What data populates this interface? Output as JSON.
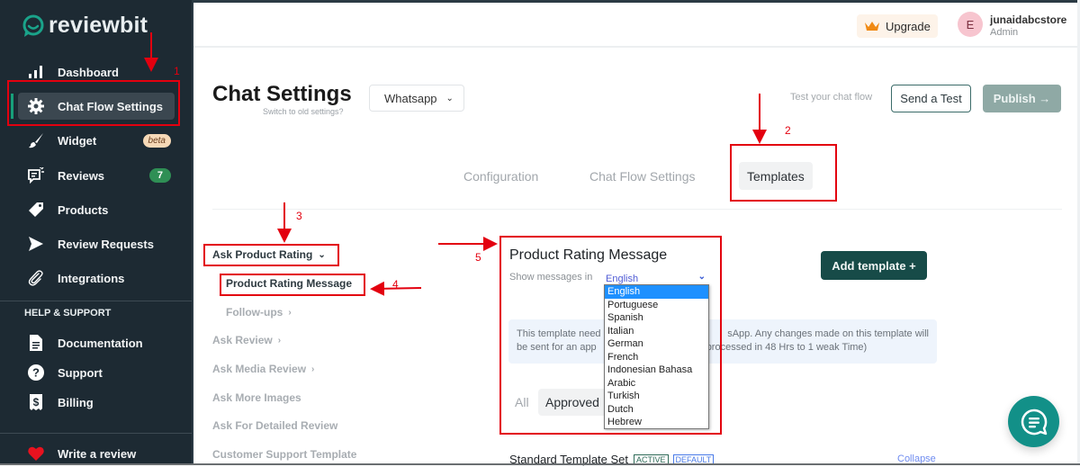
{
  "app": {
    "name": "reviewbit"
  },
  "sidebar": {
    "items": [
      {
        "label": "Dashboard",
        "icon": "bar-chart-icon"
      },
      {
        "label": "Chat Flow Settings",
        "icon": "gear-icon",
        "active": true
      },
      {
        "label": "Widget",
        "icon": "brush-icon",
        "badge": "beta"
      },
      {
        "label": "Reviews",
        "icon": "reviews-icon",
        "badge": "7"
      },
      {
        "label": "Products",
        "icon": "tag-icon"
      },
      {
        "label": "Review Requests",
        "icon": "send-icon"
      },
      {
        "label": "Integrations",
        "icon": "paperclip-icon"
      }
    ],
    "help_heading": "HELP & SUPPORT",
    "help_items": [
      {
        "label": "Documentation",
        "icon": "document-icon"
      },
      {
        "label": "Support",
        "icon": "question-icon"
      },
      {
        "label": "Billing",
        "icon": "billing-icon"
      }
    ],
    "footer_item": {
      "label": "Write a review",
      "icon": "heart-icon"
    }
  },
  "header": {
    "upgrade_label": "Upgrade",
    "user": {
      "initial": "E",
      "name": "junaidabcstore",
      "role": "Admin"
    }
  },
  "page": {
    "title": "Chat Settings",
    "switch_link": "Switch to old settings?",
    "channel": "Whatsapp",
    "test_label": "Test your chat flow",
    "send_test_label": "Send a Test",
    "publish_label": "Publish →"
  },
  "tabs": [
    {
      "label": "Configuration",
      "active": false
    },
    {
      "label": "Chat Flow Settings",
      "active": false
    },
    {
      "label": "Templates",
      "active": true
    }
  ],
  "template_menu": [
    {
      "label": "Ask Product Rating",
      "chevron": "down",
      "expanded": true
    },
    {
      "label": "Product Rating Message",
      "selected": true
    },
    {
      "label": "Follow-ups",
      "chevron": "right"
    },
    {
      "label": "Ask Review",
      "chevron": "right"
    },
    {
      "label": "Ask Media Review",
      "chevron": "right"
    },
    {
      "label": "Ask More Images"
    },
    {
      "label": "Ask For Detailed Review"
    },
    {
      "label": "Customer Support Template"
    }
  ],
  "card": {
    "title": "Product Rating Message",
    "show_label": "Show messages in",
    "language": "English",
    "info_line1_a": "This template need",
    "info_line1_b": "sApp. Any changes made on this template will",
    "info_line2_a": "be sent for an app",
    "info_line2_b": "processed in 48 Hrs to 1 weak Time)",
    "filters": {
      "all": "All",
      "approved": "Approved"
    },
    "add_template_label": "Add template +",
    "template_set": {
      "title": "Standard Template Set",
      "active_tag": "ACTIVE",
      "default_tag": "DEFAULT",
      "collapse": "Collapse"
    }
  },
  "language_options": [
    "English",
    "Portuguese",
    "Spanish",
    "Italian",
    "German",
    "French",
    "Indonesian Bahasa",
    "Arabic",
    "Turkish",
    "Dutch",
    "Hebrew"
  ],
  "annotations": [
    "1",
    "2",
    "3",
    "4",
    "5"
  ],
  "colors": {
    "accent": "#174b48",
    "sidebar_bg": "#1d2a33",
    "annotation": "#e3000f",
    "fab": "#129088"
  }
}
